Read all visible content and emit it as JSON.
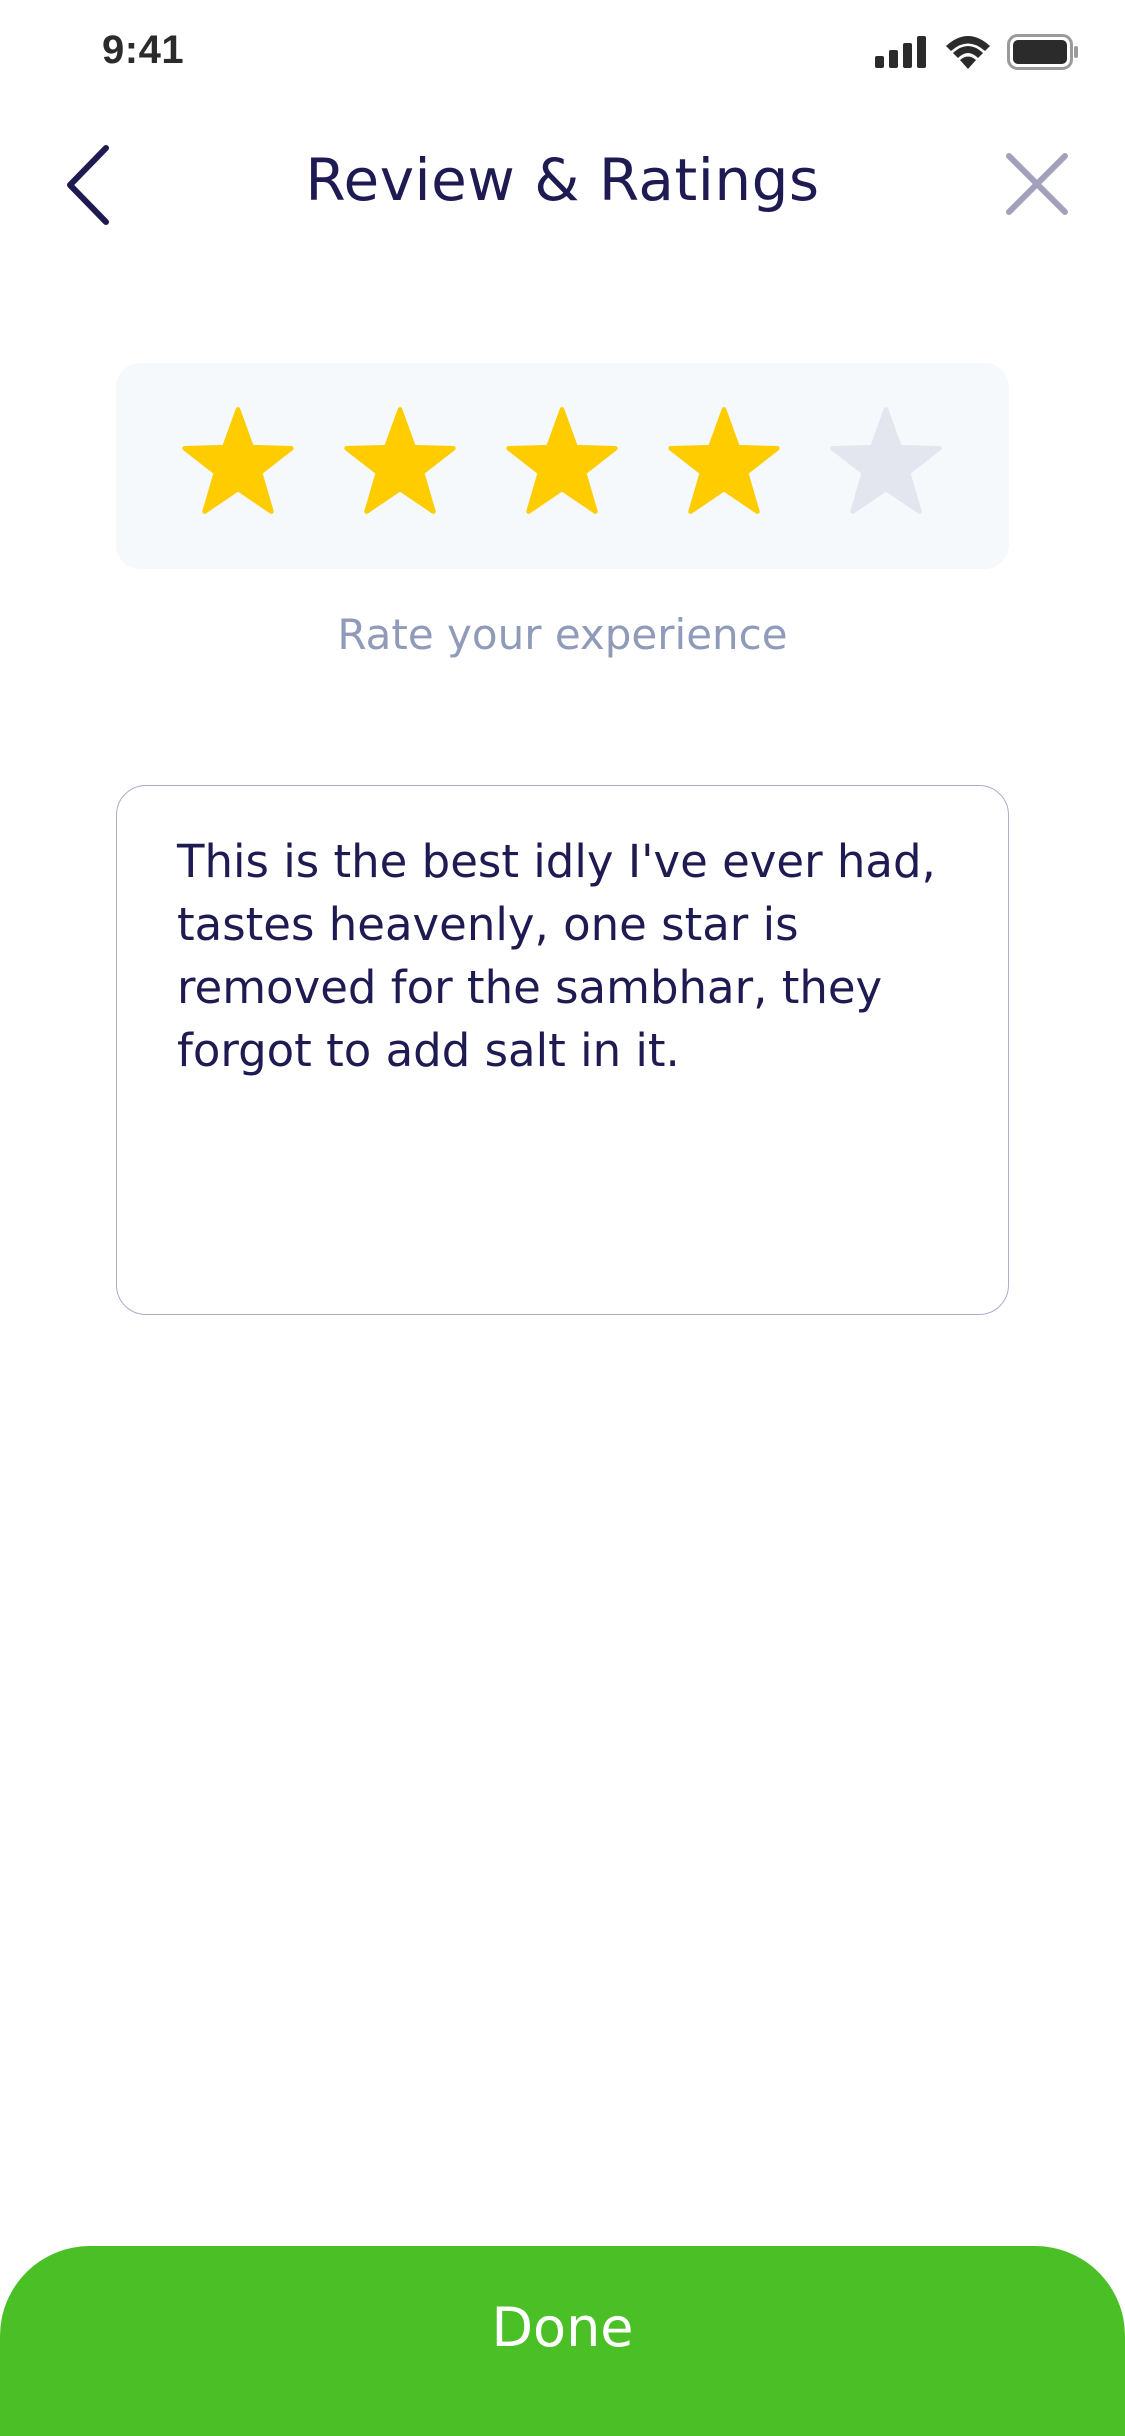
{
  "status_bar": {
    "time": "9:41",
    "icons": [
      "signal-icon",
      "wifi-icon",
      "battery-icon"
    ]
  },
  "header": {
    "title": "Review & Ratings",
    "back_icon": "chevron-left-icon",
    "close_icon": "close-icon"
  },
  "rating": {
    "value": 4,
    "max": 5,
    "label": "Rate your experience",
    "filled_color": "#FFCC00",
    "empty_color": "#E3E6EE"
  },
  "review": {
    "value": "This is the best idly I've ever had, tastes heavenly, one star is removed for the sambhar, they forgot to add salt in it."
  },
  "done_button": {
    "label": "Done",
    "color": "#4AC026"
  },
  "colors": {
    "title": "#1E1A52",
    "muted_label": "#8F9BB9",
    "card_background": "#F5F9FC",
    "close_icon": "#A3A0BB"
  }
}
